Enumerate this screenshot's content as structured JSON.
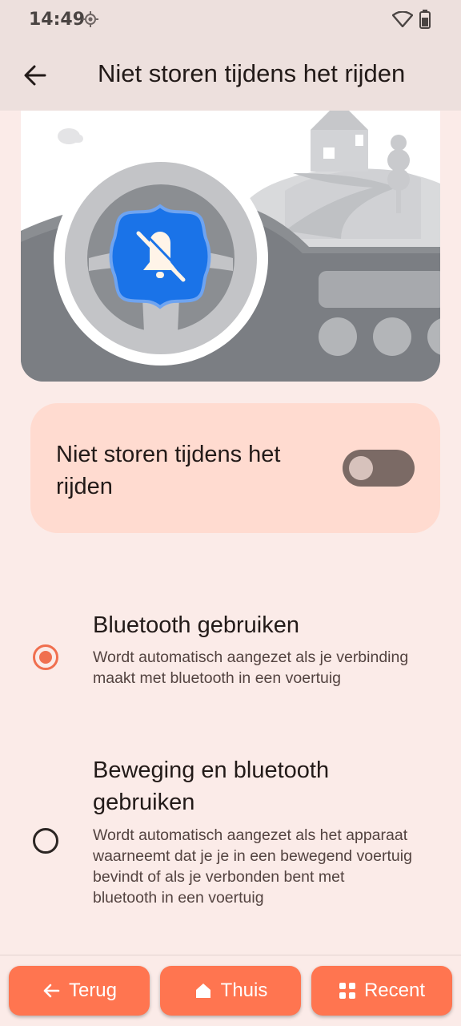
{
  "status_bar": {
    "time": "14:49",
    "icons": [
      "location-icon",
      "wifi-icon",
      "battery-icon"
    ]
  },
  "header": {
    "title": "Niet storen tijdens het rijden",
    "back_icon": "arrow-left-icon"
  },
  "illustration": {
    "badge_icon": "bell-off-icon"
  },
  "main_toggle": {
    "label": "Niet storen tijdens het rijden",
    "enabled": false
  },
  "options": [
    {
      "title": "Bluetooth gebruiken",
      "description": "Wordt automatisch aangezet als je verbinding maakt met bluetooth in een voertuig",
      "selected": true
    },
    {
      "title": "Beweging en bluetooth gebruiken",
      "description": "Wordt automatisch aangezet als het apparaat waarneemt dat je je in een bewegend voertuig bevindt of als je verbonden bent met bluetooth in een voertuig",
      "selected": false
    }
  ],
  "nav": {
    "back": "Terug",
    "home": "Thuis",
    "recent": "Recent"
  },
  "colors": {
    "accent": "#ff7550",
    "radio_selected": "#f06f4f",
    "card_background": "#ffdbd0",
    "page_background": "#fbebe8",
    "badge_blue": "#1a73e8"
  }
}
